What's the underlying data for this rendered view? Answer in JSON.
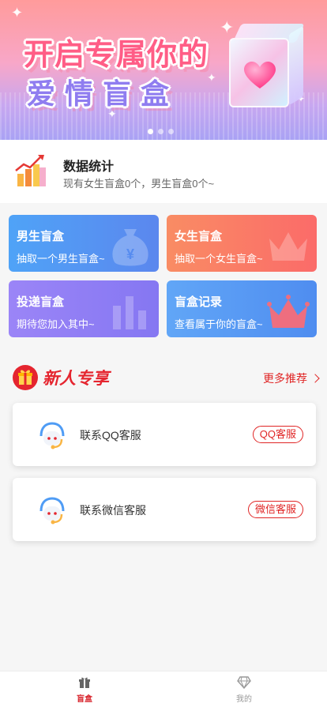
{
  "banner": {
    "line1": "开启专属你的",
    "line2": "爱情盲盒",
    "dots": 3,
    "active_dot": 0
  },
  "stats": {
    "title": "数据统计",
    "desc": "现有女生盲盒0个，男生盲盒0个~"
  },
  "cards": [
    {
      "title": "男生盲盒",
      "sub": "抽取一个男生盲盒~",
      "color": "#5b87ee",
      "icon": "money-bag-icon"
    },
    {
      "title": "女生盲盒",
      "sub": "抽取一个女生盲盒~",
      "color": "#fb6b69",
      "icon": "crown-icon"
    },
    {
      "title": "投递盲盒",
      "sub": "期待您加入其中~",
      "color": "#8577f2",
      "icon": "bar-chart-icon"
    },
    {
      "title": "盲盒记录",
      "sub": "查看属于你的盲盒~",
      "color": "#4f8df0",
      "icon": "crown-icon"
    }
  ],
  "section": {
    "title": "新人专享",
    "more": "更多推荐"
  },
  "services": [
    {
      "label": "联系QQ客服",
      "button": "QQ客服"
    },
    {
      "label": "联系微信客服",
      "button": "微信客服"
    }
  ],
  "tabbar": {
    "items": [
      {
        "label": "盲盒",
        "icon": "gift-icon",
        "active": true
      },
      {
        "label": "我的",
        "icon": "diamond-icon",
        "active": false
      }
    ],
    "active_color": "#d8262e"
  }
}
